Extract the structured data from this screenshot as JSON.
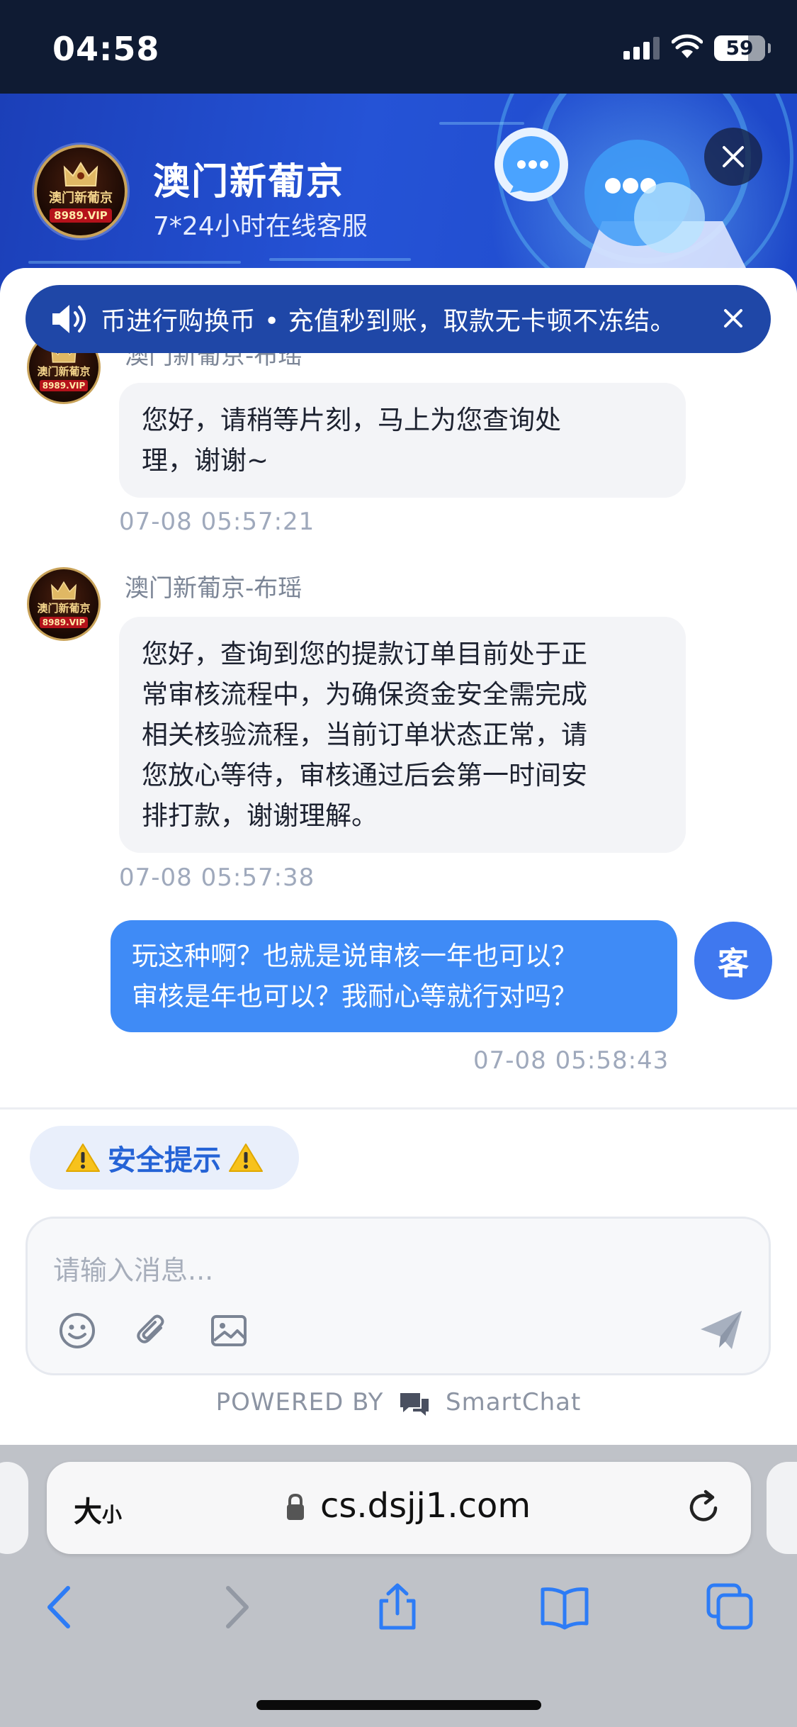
{
  "status_bar": {
    "time": "04:58",
    "battery": "59"
  },
  "header": {
    "title": "澳门新葡京",
    "subtitle": "7*24小时在线客服",
    "logo_text": "澳门新葡京",
    "logo_site": "8989.VIP"
  },
  "notice": {
    "text": "币进行购换币 • 充值秒到账，取款无卡顿不冻结。"
  },
  "messages": [
    {
      "sender": "澳门新葡京-布瑶",
      "text_lines": [
        "您好，请稍等片刻，马上为您查询处",
        "理，谢谢~"
      ],
      "time": "07-08 05:57:21"
    },
    {
      "sender": "澳门新葡京-布瑶",
      "text_lines": [
        "您好，查询到您的提款订单目前处于正",
        "常审核流程中，为确保资金安全需完成",
        "相关核验流程，当前订单状态正常，请",
        "您放心等待，审核通过后会第一时间安",
        "排打款，谢谢理解。"
      ],
      "time": "07-08 05:57:38"
    },
    {
      "sender": "",
      "text_lines": [
        "玩这种啊？也就是说审核一年也可以？",
        "审核是年也可以？我耐心等就行对吗？"
      ],
      "time": "07-08 05:58:43",
      "avatar_label": "客"
    }
  ],
  "safety_tip": "安全提示",
  "composer": {
    "placeholder": "请输入消息..."
  },
  "powered_by": {
    "prefix": "POWERED BY",
    "brand": "SmartChat"
  },
  "safari": {
    "text_size_label": "大",
    "text_size_small": "小",
    "url": "cs.dsjj1.com"
  },
  "colors": {
    "accent": "#3f8bf6",
    "notice_bg": "#1f47a7",
    "header_bg": "#2553d6"
  }
}
